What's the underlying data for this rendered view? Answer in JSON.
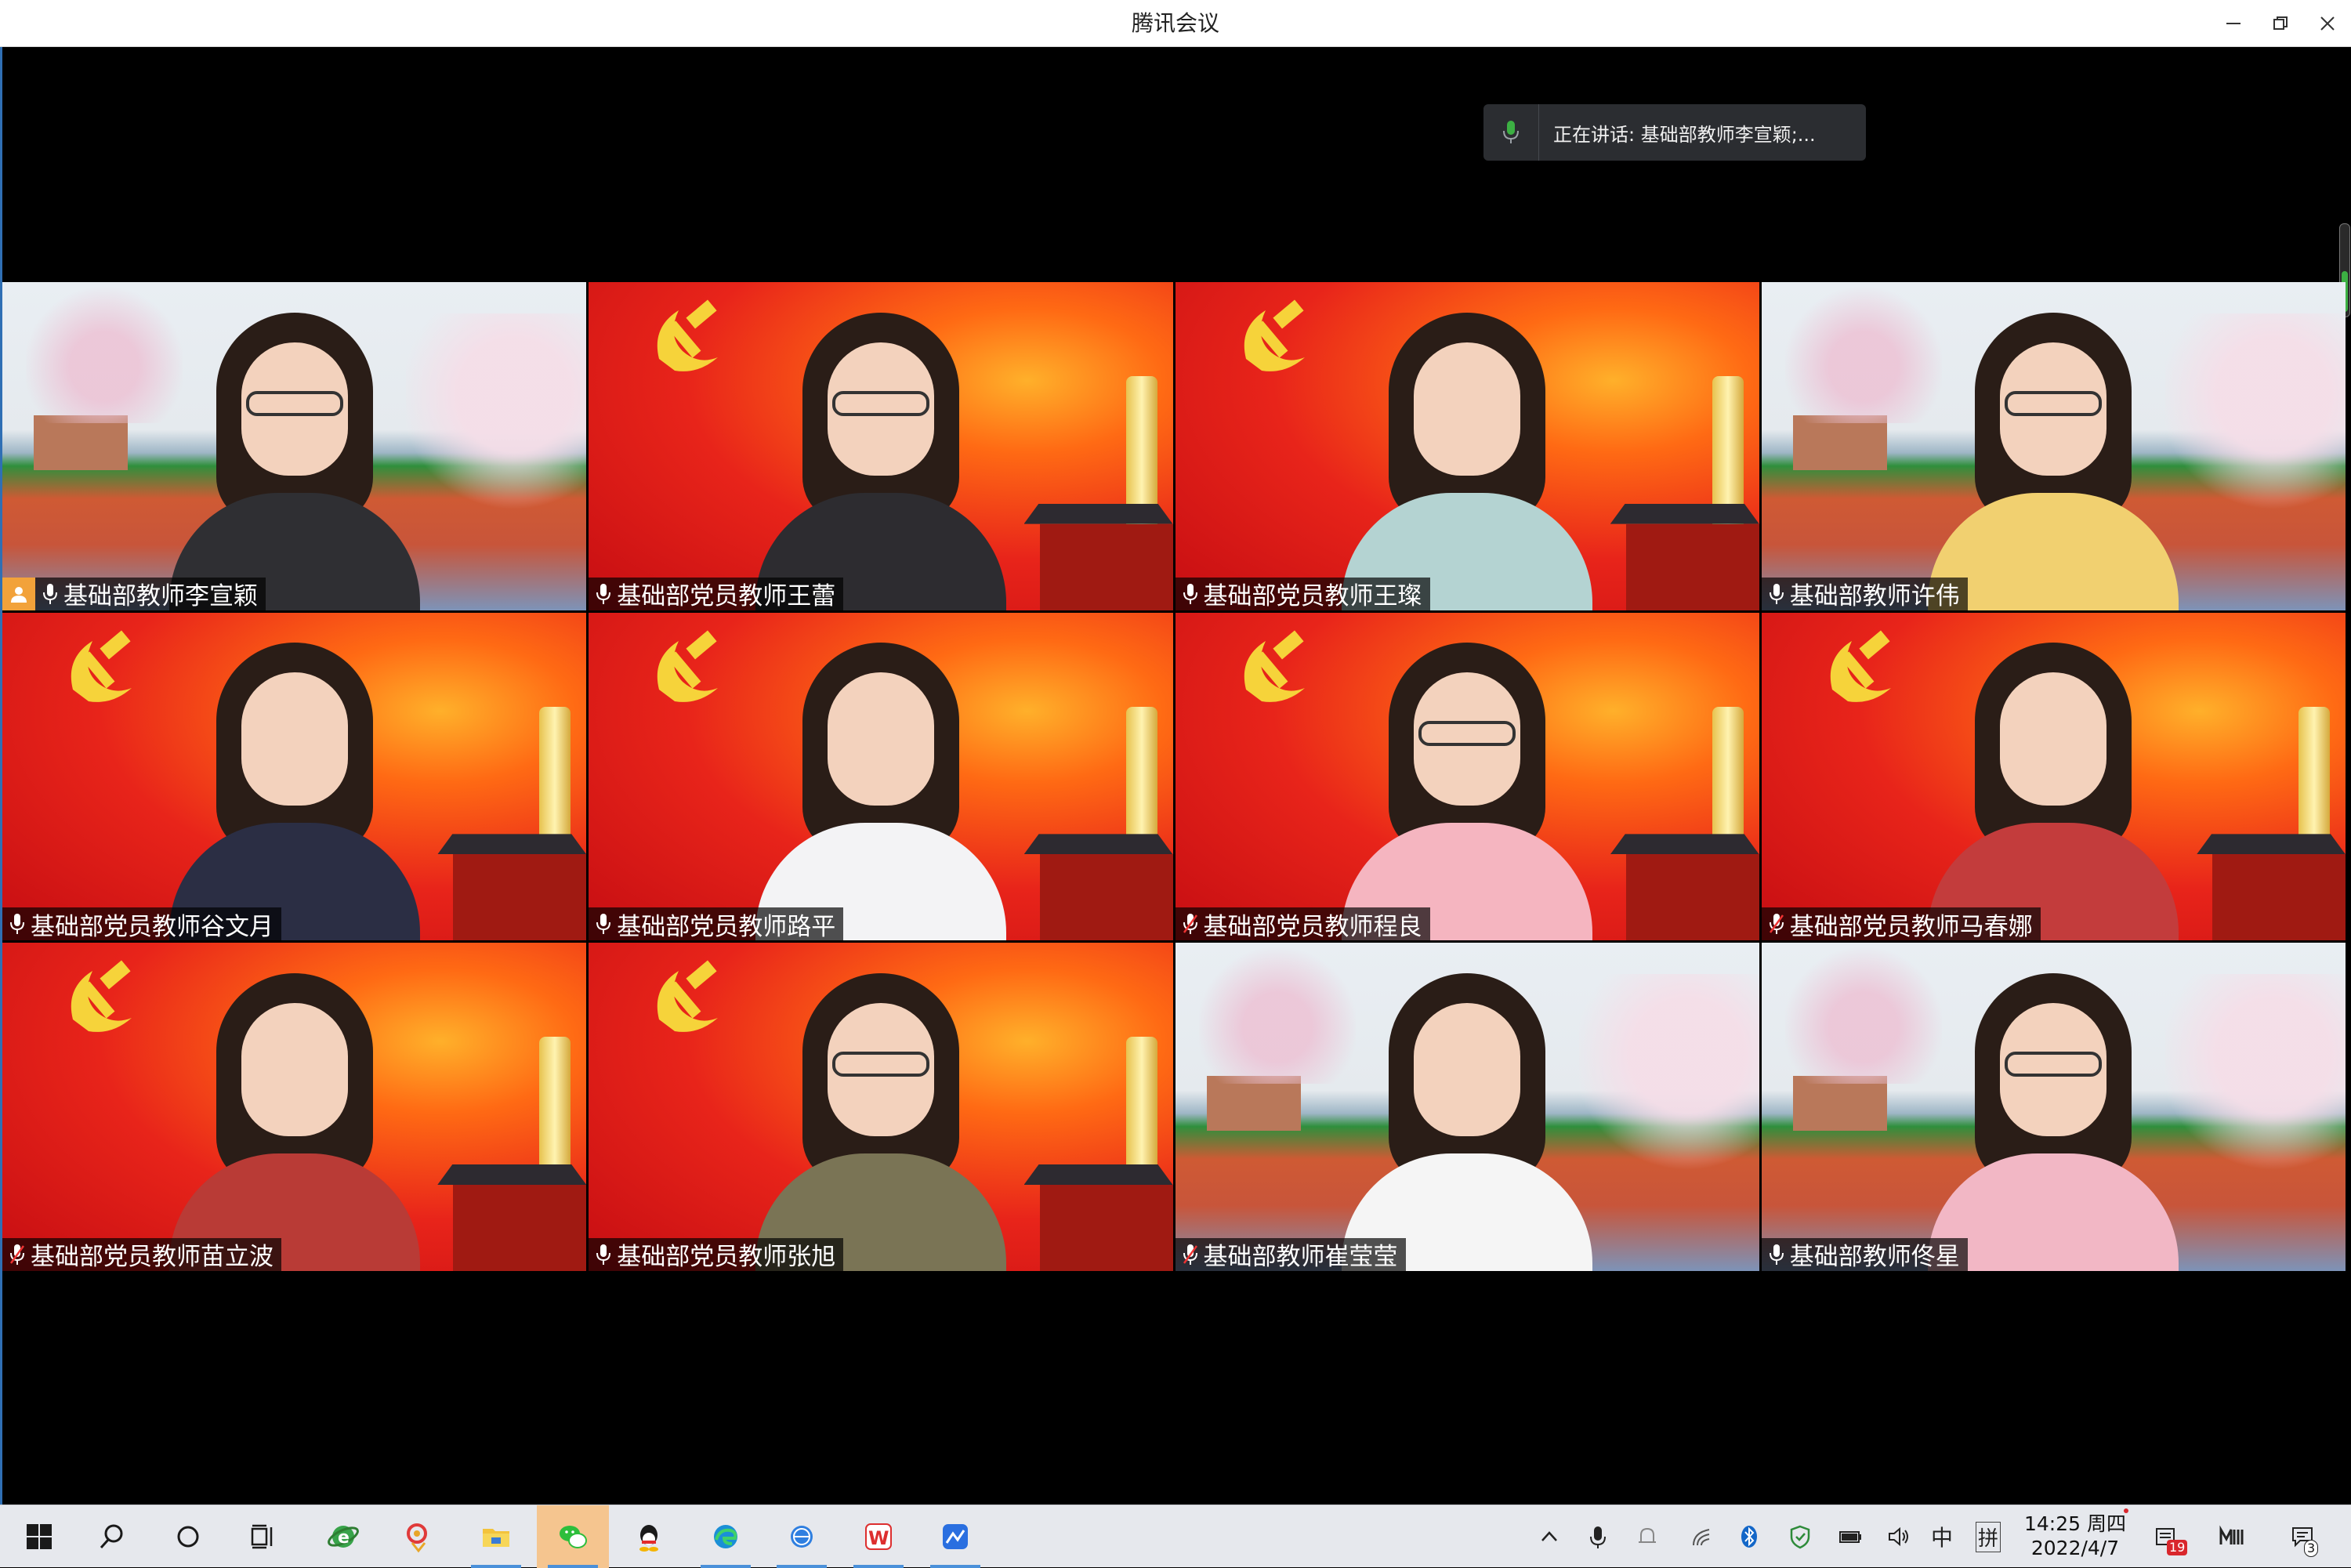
{
  "window": {
    "title": "腾讯会议"
  },
  "speaking": {
    "text": "正在讲话: 基础部教师李宣颖;..."
  },
  "participants": [
    {
      "name": "基础部教师李宣颖",
      "background": "campus",
      "host": true,
      "mic": "on"
    },
    {
      "name": "基础部党员教师王蕾",
      "background": "red",
      "host": false,
      "mic": "on"
    },
    {
      "name": "基础部党员教师王璨",
      "background": "red",
      "host": false,
      "mic": "on"
    },
    {
      "name": "基础部教师许伟",
      "background": "campus",
      "host": false,
      "mic": "on"
    },
    {
      "name": "基础部党员教师谷文月",
      "background": "red",
      "host": false,
      "mic": "on"
    },
    {
      "name": "基础部党员教师路平",
      "background": "red",
      "host": false,
      "mic": "on"
    },
    {
      "name": "基础部党员教师程良",
      "background": "red",
      "host": false,
      "mic": "muted"
    },
    {
      "name": "基础部党员教师马春娜",
      "background": "red",
      "host": false,
      "mic": "muted"
    },
    {
      "name": "基础部党员教师苗立波",
      "background": "red",
      "host": false,
      "mic": "muted"
    },
    {
      "name": "基础部党员教师张旭",
      "background": "red",
      "host": false,
      "mic": "on"
    },
    {
      "name": "基础部教师崔莹莹",
      "background": "campus",
      "host": false,
      "mic": "muted"
    },
    {
      "name": "基础部教师佟星",
      "background": "campus",
      "host": false,
      "mic": "on"
    }
  ],
  "taskbar": {
    "apps": [
      {
        "icon": "windows-start-icon"
      },
      {
        "icon": "search-icon"
      },
      {
        "icon": "cortana-icon"
      },
      {
        "icon": "task-view-icon"
      },
      {
        "icon": "ie-browser-icon"
      },
      {
        "icon": "tencent-meeting-icon"
      },
      {
        "icon": "file-explorer-icon"
      },
      {
        "icon": "wechat-icon"
      },
      {
        "icon": "qq-icon"
      },
      {
        "icon": "edge-browser-icon"
      },
      {
        "icon": "network-app-icon"
      },
      {
        "icon": "wps-icon"
      },
      {
        "icon": "dingtalk-icon"
      }
    ],
    "tray": {
      "ime_lang": "中",
      "ime_mode": "拼",
      "time": "14:25 周四",
      "date": "2022/4/7",
      "mail_badge": "19",
      "notification_badge": "3"
    }
  },
  "colors": {
    "accent": "#2f6fb4",
    "host_badge": "#f2a23a",
    "mic_active": "#3cb043",
    "taskbar_active": "#f5c58f"
  }
}
